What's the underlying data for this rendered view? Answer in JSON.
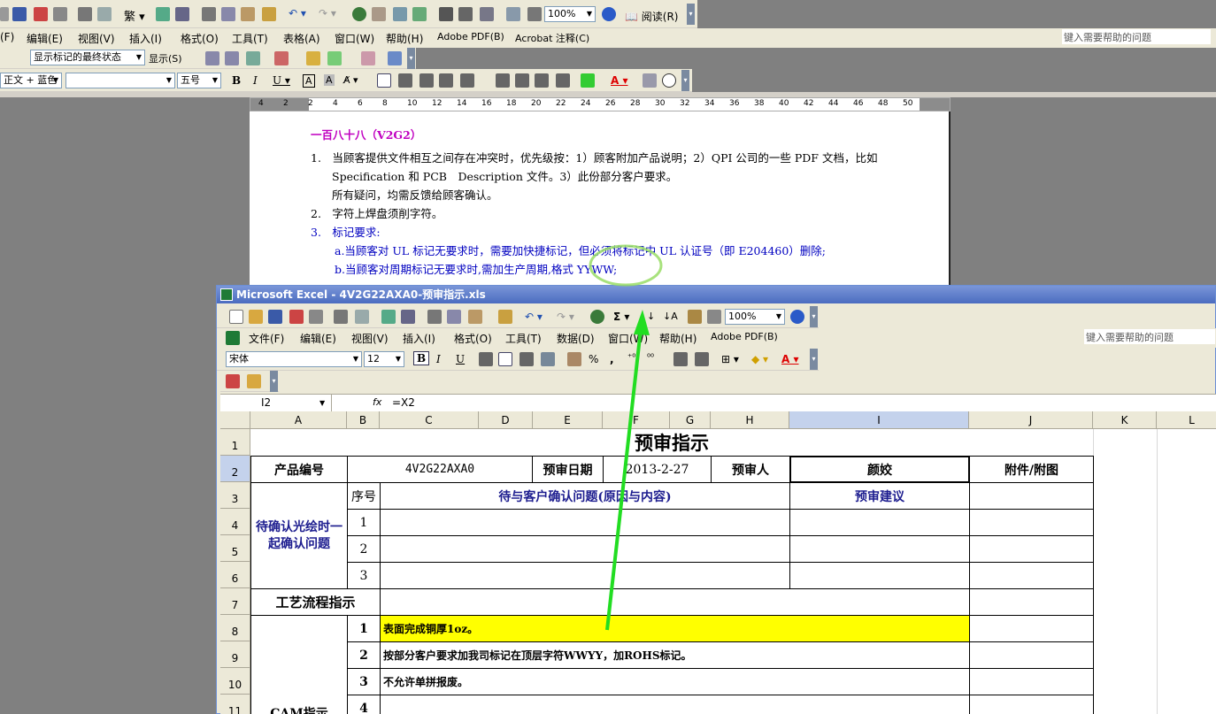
{
  "word": {
    "menu": [
      "(F)",
      "编辑(E)",
      "视图(V)",
      "插入(I)",
      "格式(O)",
      "工具(T)",
      "表格(A)",
      "窗口(W)",
      "帮助(H)",
      "Adobe PDF(B)",
      "Acrobat 注释(C)"
    ],
    "help_placeholder": "键入需要帮助的问题",
    "zoom": "100%",
    "read_label": "阅读(R)",
    "track_state": "显示标记的最终状态",
    "show_label": "显示(S)",
    "style_combo": "正文 + 蓝色",
    "font_combo": "",
    "size_combo": "五号",
    "ruler_ticks": [
      "4",
      "2",
      "2",
      "4",
      "6",
      "8",
      "10",
      "12",
      "14",
      "16",
      "18",
      "20",
      "22",
      "24",
      "26",
      "28",
      "30",
      "32",
      "34",
      "36",
      "38",
      "40",
      "42",
      "44",
      "46",
      "48",
      "50"
    ],
    "doc": {
      "heading": "一百八十八（V2G2）",
      "line1": "1.　当顾客提供文件相互之间存在冲突时，优先级按：1）顾客附加产品说明；2）QPI 公司的一些 PDF 文档，比如",
      "line2": "Specification 和 PCB　Description 文件。3）此份部分客户要求。",
      "line3": "所有疑问，均需反馈给顾客确认。",
      "line4": "2.　字符上焊盘须削字符。",
      "line5": "3.　标记要求:",
      "line6": "a.当顾客对 UL 标记无要求时，需要加快捷标记，但必须将标记中 UL 认证号（即 E204460）删除;",
      "line7": "b.当顾客对周期标记无要求时,需加生产周期,格式 YYWW;"
    }
  },
  "excel": {
    "title": "Microsoft Excel - 4V2G22AXA0-预审指示.xls",
    "menu": [
      "文件(F)",
      "编辑(E)",
      "视图(V)",
      "插入(I)",
      "格式(O)",
      "工具(T)",
      "数据(D)",
      "窗口(W)",
      "帮助(H)",
      "Adobe PDF(B)"
    ],
    "help_placeholder": "键入需要帮助的问题",
    "zoom": "100%",
    "font": "宋体",
    "size": "12",
    "name_box": "I2",
    "fx": "fx",
    "formula": "=X2",
    "columns": [
      "A",
      "B",
      "C",
      "D",
      "E",
      "F",
      "G",
      "H",
      "I",
      "J",
      "K",
      "L"
    ],
    "rows": [
      "1",
      "2",
      "3",
      "4",
      "5",
      "6",
      "7",
      "8",
      "9",
      "10",
      "11"
    ],
    "cells": {
      "title": "预审指示",
      "product_no_label": "产品编号",
      "product_no": "4V2G22AXA0",
      "review_date_label": "预审日期",
      "review_date": "2013-2-27",
      "reviewer_label": "预审人",
      "reviewer": "颜姣",
      "attachment": "附件/附图",
      "pending_label": "待确认光绘时一起确认问题",
      "seq_label": "序号",
      "issue_header": "待与客户确认问题(原因与内容)",
      "advice_header": "预审建议",
      "seq": [
        "1",
        "2",
        "3"
      ],
      "process_label": "工艺流程指示",
      "cam_label": "CAM指示",
      "cam_seq": [
        "1",
        "2",
        "3",
        "4"
      ],
      "cam_items": [
        "表面完成铜厚1oz。",
        "按部分客户要求加我司标记在顶层字符WWYY，加ROHS标记。",
        "不允许单拼报废。",
        ""
      ]
    }
  },
  "colors": {
    "highlight_yellow": "#ffff00",
    "annotation_green": "#33dd33",
    "title_blue": "#4b6cc0"
  }
}
